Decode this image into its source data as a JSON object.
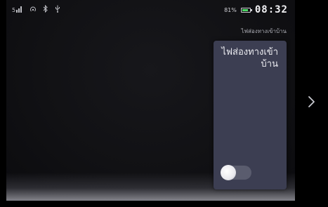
{
  "status": {
    "battery_percent": "81%",
    "battery_level": 0.81,
    "time": "08:32",
    "icons": [
      "signal-icon",
      "hotspot-icon",
      "bluetooth-icon",
      "usb-icon"
    ]
  },
  "app": {
    "title": "ไฟส่องทางเข้าบ้าน"
  },
  "card": {
    "title": "ไฟส่องทางเข้าบ้าน",
    "switch_on": false
  },
  "nav": {
    "next_icon": "chevron-right-icon"
  },
  "colors": {
    "card_bg": "#3c3e52",
    "toggle_track": "#5a5c6e",
    "battery_fill": "#4cd964"
  }
}
